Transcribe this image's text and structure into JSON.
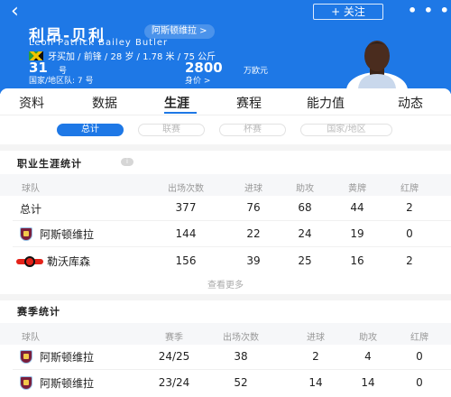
{
  "header": {
    "back_icon": "‹",
    "follow_label": "+ 关注",
    "more_label": "• • •",
    "name_cn": "利昂-贝利",
    "club_chip": "阿斯顿维拉 >",
    "name_en": "Leon Patrick Bailey Butler",
    "info": "牙买加 / 前锋 / 28 岁 / 1.78 米 / 75 公斤",
    "number_value": "31",
    "number_unit": "号",
    "national_line": "国家/地区队: 7 号",
    "value_amount": "2800",
    "value_unit": "万欧元",
    "value_label": "身价 >",
    "colors": {
      "accent": "#1e78e6"
    }
  },
  "tabs": [
    "资料",
    "数据",
    "生涯",
    "赛程",
    "能力值",
    "动态"
  ],
  "active_tab": "生涯",
  "chips": [
    "总计",
    "联赛",
    "杯赛",
    "国家/地区"
  ],
  "active_chip": "总计",
  "career": {
    "title": "职业生涯统计",
    "info_icon": "i",
    "headers": [
      "球队",
      "出场次数",
      "进球",
      "助攻",
      "黄牌",
      "红牌"
    ],
    "total_row": {
      "label": "总计",
      "apps": "377",
      "goals": "76",
      "assists": "68",
      "yellow": "44",
      "red": "2"
    },
    "rows": [
      {
        "team": "阿斯顿维拉",
        "badge": "villa-badge-icon",
        "apps": "144",
        "goals": "22",
        "assists": "24",
        "yellow": "19",
        "red": "0"
      },
      {
        "team": "勒沃库森",
        "badge": "leverkusen-badge-icon",
        "apps": "156",
        "goals": "39",
        "assists": "25",
        "yellow": "16",
        "red": "2"
      }
    ],
    "more_label": "查看更多"
  },
  "season": {
    "title": "赛季统计",
    "headers": [
      "球队",
      "赛季",
      "出场次数",
      "进球",
      "助攻",
      "红牌"
    ],
    "rows": [
      {
        "team": "阿斯顿维拉",
        "season": "24/25",
        "apps": "38",
        "goals": "2",
        "assists": "4",
        "red": "0"
      },
      {
        "team": "阿斯顿维拉",
        "season": "23/24",
        "apps": "52",
        "goals": "14",
        "assists": "14",
        "red": "0"
      }
    ]
  }
}
